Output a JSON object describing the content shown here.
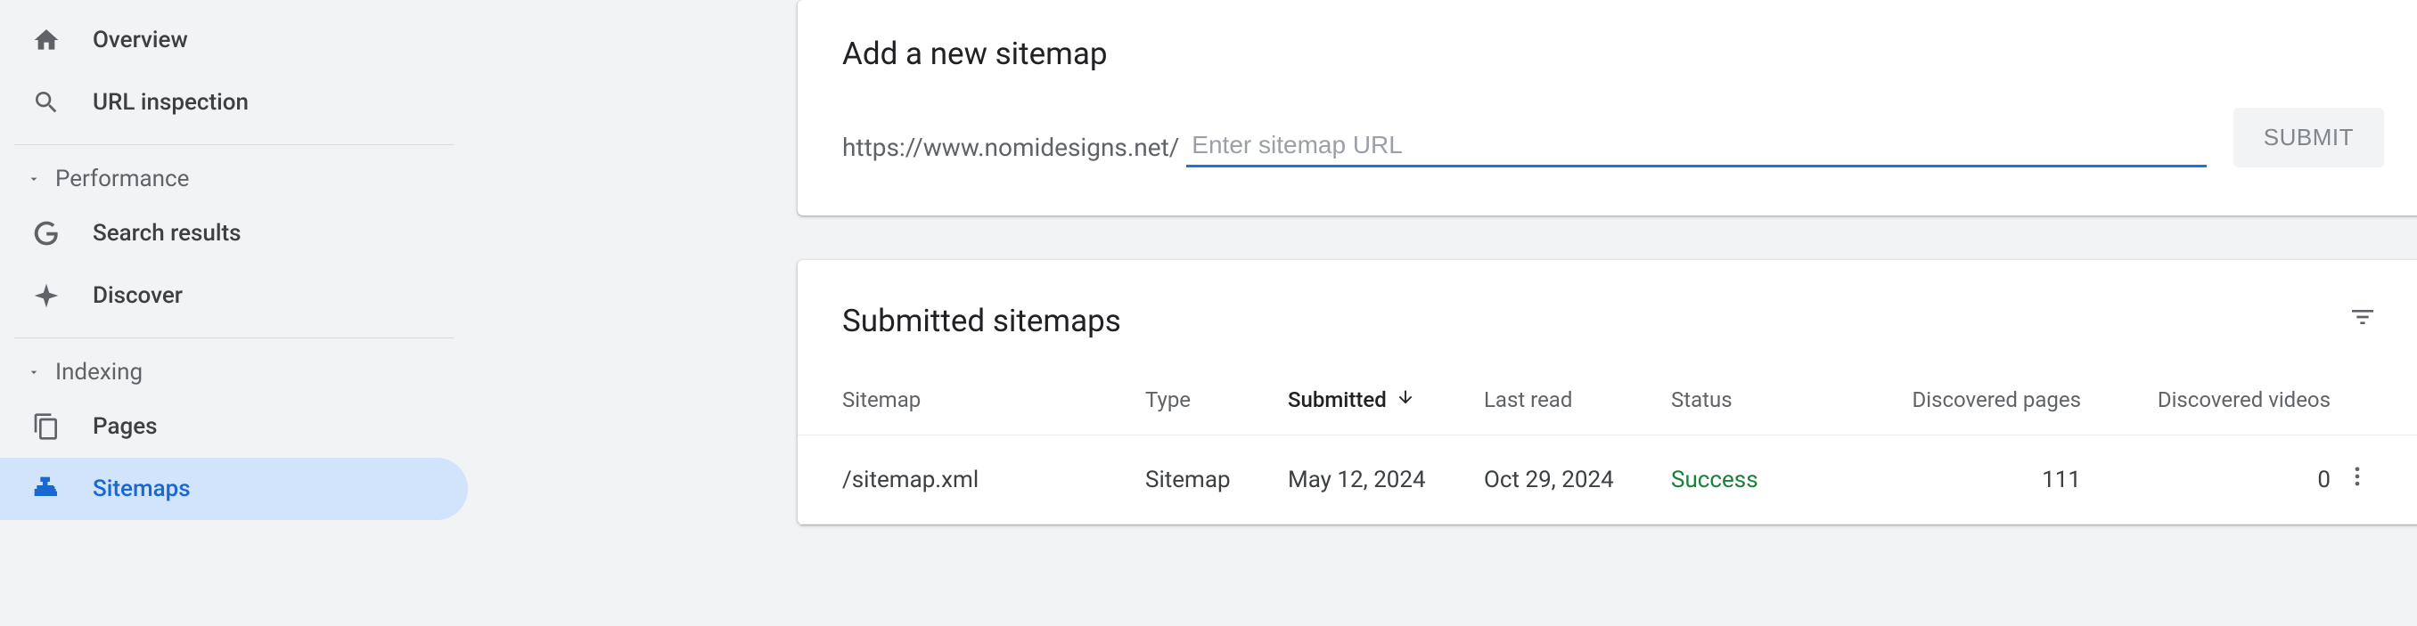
{
  "sidebar": {
    "items": [
      {
        "label": "Overview"
      },
      {
        "label": "URL inspection"
      }
    ],
    "sections": [
      {
        "label": "Performance",
        "items": [
          {
            "label": "Search results"
          },
          {
            "label": "Discover"
          }
        ]
      },
      {
        "label": "Indexing",
        "items": [
          {
            "label": "Pages"
          },
          {
            "label": "Sitemaps"
          }
        ]
      }
    ]
  },
  "add_card": {
    "title": "Add a new sitemap",
    "url_prefix": "https://www.nomidesigns.net/",
    "placeholder": "Enter sitemap URL",
    "submit_label": "SUBMIT"
  },
  "list_card": {
    "title": "Submitted sitemaps",
    "columns": {
      "sitemap": "Sitemap",
      "type": "Type",
      "submitted": "Submitted",
      "last_read": "Last read",
      "status": "Status",
      "pages": "Discovered pages",
      "videos": "Discovered videos"
    },
    "rows": [
      {
        "sitemap": "/sitemap.xml",
        "type": "Sitemap",
        "submitted": "May 12, 2024",
        "last_read": "Oct 29, 2024",
        "status": "Success",
        "pages": "111",
        "videos": "0"
      }
    ]
  }
}
